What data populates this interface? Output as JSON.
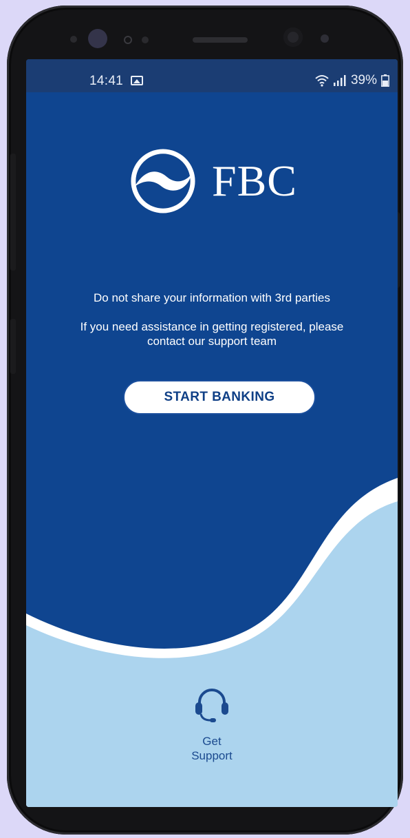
{
  "status_bar": {
    "time": "14:41",
    "battery": "39%",
    "icons": [
      "gallery-icon",
      "wifi-icon",
      "signal-icon",
      "battery-icon"
    ]
  },
  "brand": {
    "name": "FBC",
    "logo_icon": "fbc-swoosh-logo"
  },
  "content": {
    "notice_1": "Do not share your information with 3rd parties",
    "notice_2": "If you need assistance in getting registered, please contact our support team"
  },
  "actions": {
    "start_label": "START BANKING"
  },
  "support": {
    "label_line1": "Get",
    "label_line2": "Support",
    "icon": "headset-icon"
  },
  "colors": {
    "primary_blue": "#0f4590",
    "status_bar": "#1b3d73",
    "light_blue": "#acd4ee",
    "white": "#ffffff"
  }
}
